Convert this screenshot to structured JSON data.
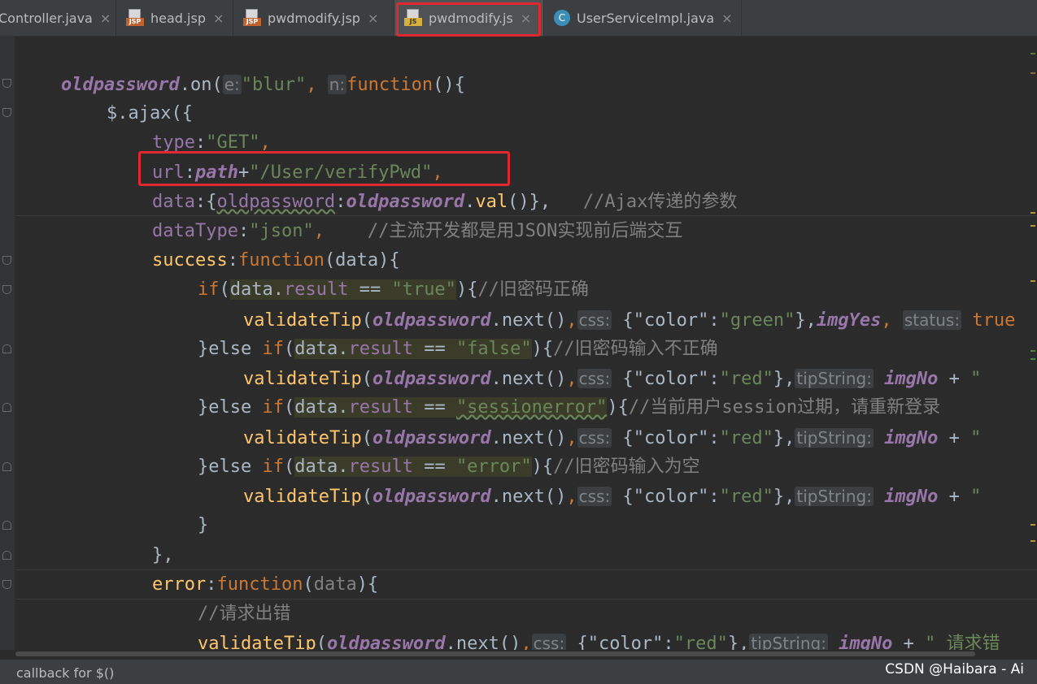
{
  "tabs": [
    {
      "label": "Controller.java",
      "icon": "java-class-icon"
    },
    {
      "label": "head.jsp",
      "icon": "jsp-file-icon"
    },
    {
      "label": "pwdmodify.jsp",
      "icon": "jsp-file-icon"
    },
    {
      "label": "pwdmodify.js",
      "icon": "js-file-icon",
      "active": true
    },
    {
      "label": "UserServiceImpl.java",
      "icon": "java-class-icon"
    }
  ],
  "icon_badges": {
    "jsp": "JSP",
    "js": "JS",
    "class": "C"
  },
  "close_glyph": "×",
  "code": {
    "l1": {
      "a": "oldpassword",
      "b": ".on(",
      "h1": "e:",
      "c": "\"blur\"",
      "d": ",",
      "h2": "n:",
      "e": "function",
      "f": "(){"
    },
    "l2": {
      "a": "$.ajax({"
    },
    "l3": {
      "a": "type",
      "b": ":",
      "c": "\"GET\"",
      "d": ","
    },
    "l4": {
      "a": "url",
      "b": ":",
      "c": "path",
      "d": "+",
      "e": "\"/User/verifyPwd\"",
      "f": ","
    },
    "l5": {
      "a": "data",
      "b": ":{",
      "c": "oldpassword",
      "d": ":",
      "e": "oldpassword",
      "f": ".",
      "g": "val",
      "h": "()},",
      "i": "   //Ajax传递的参数"
    },
    "l6": {
      "a": "dataType",
      "b": ":",
      "c": "\"json\"",
      "d": ",",
      "e": "    //主流开发都是用JSON实现前后端交互"
    },
    "l7": {
      "a": "success",
      "b": ":",
      "c": "function",
      "d": "(data){"
    },
    "l8": {
      "a": "if",
      "b": "(",
      "c": "data.",
      "d": "result",
      "e": " == ",
      "f": "\"true\"",
      "g": ")",
      "h": "{",
      "i": "//旧密码正确"
    },
    "l9": {
      "a": "validateTip",
      "b": "(",
      "c": "oldpassword",
      "d": ".next()",
      "e": ",",
      "h1": "css:",
      "f": "{\"color\":",
      "g": "\"green\"",
      "i": "},",
      "j": "imgYes",
      "k": ",",
      "h2": "status:",
      "l": "true"
    },
    "l10": {
      "a": "}else ",
      "b": "if",
      "c": "(",
      "d": "data.",
      "e": "result",
      "f": " == ",
      "g": "\"false\"",
      "h": ")",
      "i": "{",
      "j": "//旧密码输入不正确"
    },
    "l11": {
      "a": "validateTip",
      "b": "(",
      "c": "oldpassword",
      "d": ".next()",
      "e": ",",
      "h1": "css:",
      "f": "{\"color\":",
      "g": "\"red\"",
      "i": "},",
      "h2": "tipString:",
      "j": "imgNo",
      "k": " + ",
      "l": "\""
    },
    "l12": {
      "a": "}else ",
      "b": "if",
      "c": "(",
      "d": "data.",
      "e": "result",
      "f": " == ",
      "g": "\"sessionerror\"",
      "h": ")",
      "i": "{",
      "j": "//当前用户session过期，请重新登录"
    },
    "l13": {
      "a": "validateTip",
      "b": "(",
      "c": "oldpassword",
      "d": ".next()",
      "e": ",",
      "h1": "css:",
      "f": "{\"color\":",
      "g": "\"red\"",
      "i": "},",
      "h2": "tipString:",
      "j": "imgNo",
      "k": " + ",
      "l": "\""
    },
    "l14": {
      "a": "}else ",
      "b": "if",
      "c": "(",
      "d": "data.",
      "e": "result",
      "f": " == ",
      "g": "\"error\"",
      "h": ")",
      "i": "{",
      "j": "//旧密码输入为空"
    },
    "l15": {
      "a": "validateTip",
      "b": "(",
      "c": "oldpassword",
      "d": ".next()",
      "e": ",",
      "h1": "css:",
      "f": "{\"color\":",
      "g": "\"red\"",
      "i": "},",
      "h2": "tipString:",
      "j": "imgNo",
      "k": " + ",
      "l": "\""
    },
    "l16": {
      "a": "}"
    },
    "l17": {
      "a": "},"
    },
    "l18": {
      "a": "error",
      "b": ":",
      "c": "function",
      "d": "(",
      "e": "data",
      "f": "){"
    },
    "l19": {
      "a": "//请求出错"
    },
    "l20": {
      "a": "validateTip",
      "b": "(",
      "c": "oldpassword",
      "d": ".next()",
      "e": ",",
      "h1": "css:",
      "f": "{\"color\":",
      "g": "\"red\"",
      "i": "},",
      "h2": "tipString:",
      "j": "imgNo",
      "k": " + ",
      "l": "\" 请求错"
    }
  },
  "status": {
    "text": "callback for $()"
  },
  "watermark": "CSDN @Haibara - Ai",
  "colors": {
    "background": "#2b2b2b",
    "keyword": "#cc7832",
    "string": "#6a8759",
    "global_var": "#9876aa",
    "function_name": "#ffc66d",
    "comment": "#808080",
    "annotation_box": "#e0282e"
  }
}
